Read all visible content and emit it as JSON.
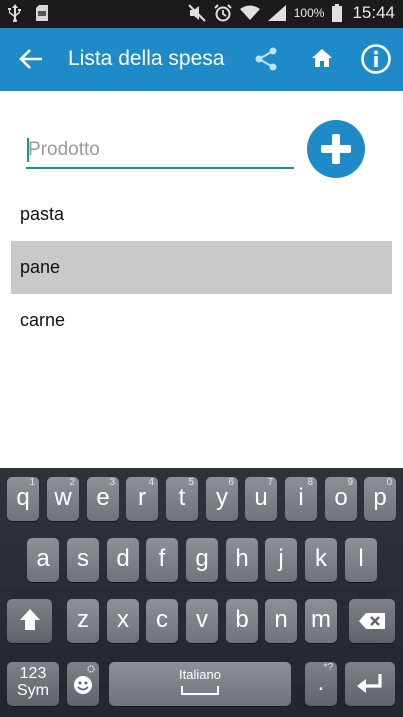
{
  "status_bar": {
    "battery_percent": "100%",
    "time": "15:44"
  },
  "app_bar": {
    "title": "Lista della spesa"
  },
  "input": {
    "value": "",
    "placeholder": "Prodotto"
  },
  "list": {
    "items": [
      {
        "label": "pasta",
        "selected": false
      },
      {
        "label": "pane",
        "selected": true
      },
      {
        "label": "carne",
        "selected": false
      }
    ]
  },
  "keyboard": {
    "row1": [
      {
        "k": "q",
        "sup": "1"
      },
      {
        "k": "w",
        "sup": "2"
      },
      {
        "k": "e",
        "sup": "3"
      },
      {
        "k": "r",
        "sup": "4"
      },
      {
        "k": "t",
        "sup": "5"
      },
      {
        "k": "y",
        "sup": "6"
      },
      {
        "k": "u",
        "sup": "7"
      },
      {
        "k": "i",
        "sup": "8"
      },
      {
        "k": "o",
        "sup": "9"
      },
      {
        "k": "p",
        "sup": "0"
      }
    ],
    "row2": [
      "a",
      "s",
      "d",
      "f",
      "g",
      "h",
      "j",
      "k",
      "l"
    ],
    "row3": [
      "z",
      "x",
      "c",
      "v",
      "b",
      "n",
      "m"
    ],
    "sym_label_1": "123",
    "sym_label_2": "Sym",
    "space_label": "Italiano",
    "period_key": ".",
    "period_sup": "*?"
  },
  "colors": {
    "accent": "#1e8ac8",
    "underline": "#0f9b8e",
    "selected_row": "#c9c9c9"
  }
}
